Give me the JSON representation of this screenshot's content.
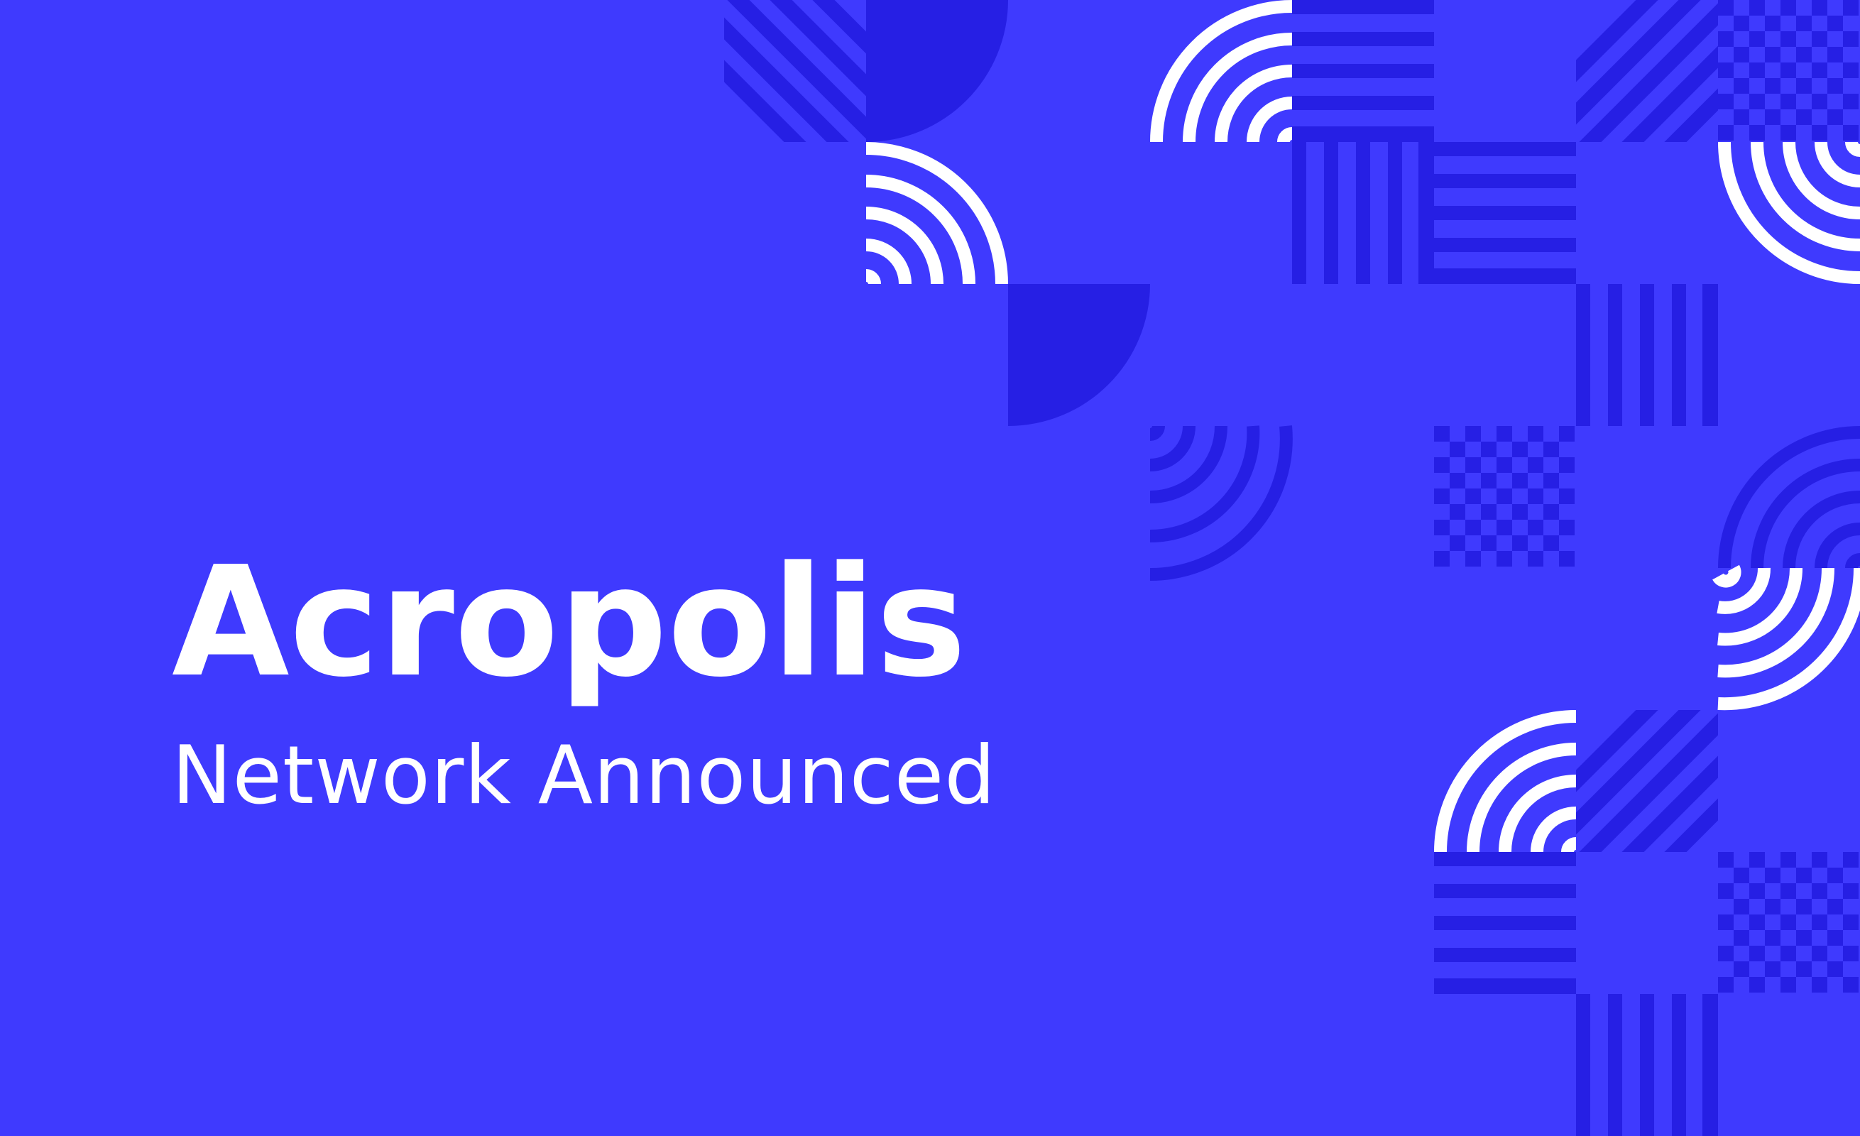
{
  "title": "Acropolis",
  "subtitle": "Network Announced",
  "colors": {
    "background": "#3f3afe",
    "dark_shape": "#261fe4",
    "white_shape": "#ffffff",
    "text": "#ffffff"
  }
}
